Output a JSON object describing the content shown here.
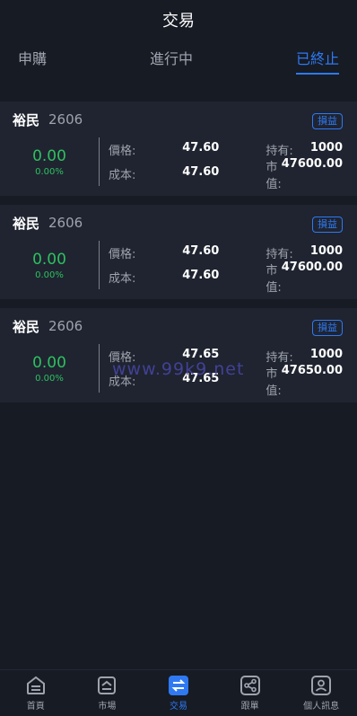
{
  "header": {
    "title": "交易"
  },
  "tabs": [
    {
      "label": "申購"
    },
    {
      "label": "進行中"
    },
    {
      "label": "已終止"
    }
  ],
  "cards": [
    {
      "name": "裕民",
      "code": "2606",
      "badge": "損益",
      "pnl": "0.00",
      "pnl_pct": "0.00%",
      "price_label": "價格:",
      "price": "47.60",
      "hold_label": "持有:",
      "hold": "1000",
      "cost_label": "成本:",
      "cost": "47.60",
      "mv_label": "市值:",
      "mv": "47600.00"
    },
    {
      "name": "裕民",
      "code": "2606",
      "badge": "損益",
      "pnl": "0.00",
      "pnl_pct": "0.00%",
      "price_label": "價格:",
      "price": "47.60",
      "hold_label": "持有:",
      "hold": "1000",
      "cost_label": "成本:",
      "cost": "47.60",
      "mv_label": "市值:",
      "mv": "47600.00"
    },
    {
      "name": "裕民",
      "code": "2606",
      "badge": "損益",
      "pnl": "0.00",
      "pnl_pct": "0.00%",
      "price_label": "價格:",
      "price": "47.65",
      "hold_label": "持有:",
      "hold": "1000",
      "cost_label": "成本:",
      "cost": "47.65",
      "mv_label": "市值:",
      "mv": "47650.00"
    }
  ],
  "watermark": "www.99k9.net",
  "nav": [
    {
      "label": "首頁",
      "icon": "home-icon"
    },
    {
      "label": "市場",
      "icon": "market-icon"
    },
    {
      "label": "交易",
      "icon": "exchange-icon"
    },
    {
      "label": "跟單",
      "icon": "share-icon"
    },
    {
      "label": "個人訊息",
      "icon": "profile-icon"
    }
  ],
  "colors": {
    "accent": "#2f79f2",
    "positive": "#2ec060",
    "background": "#171b24",
    "card": "#1f2430"
  }
}
